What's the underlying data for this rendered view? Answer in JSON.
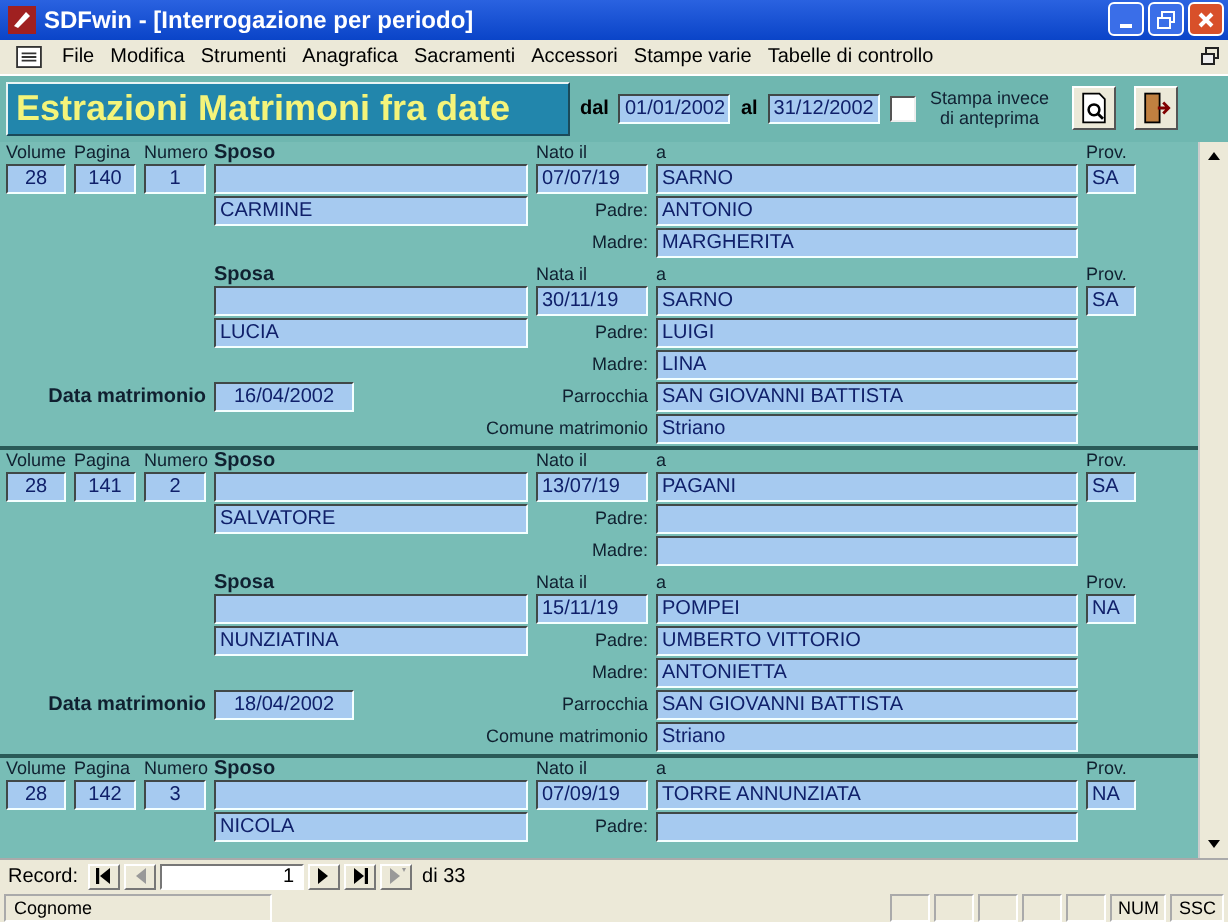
{
  "window": {
    "title": "SDFwin - [Interrogazione per periodo]"
  },
  "menu": [
    "File",
    "Modifica",
    "Strumenti",
    "Anagrafica",
    "Sacramenti",
    "Accessori",
    "Stampe varie",
    "Tabelle di controllo"
  ],
  "header": {
    "title": "Estrazioni Matrimoni fra date",
    "from_label": "dal",
    "from": "01/01/2002",
    "to_label": "al",
    "to": "31/12/2002",
    "print_checkbox": {
      "label": "Stampa invece di anteprima",
      "checked": false
    }
  },
  "records": [
    {
      "volume_label": "Volume",
      "volume": "28",
      "pagina_label": "Pagina",
      "pagina": "140",
      "numero_label": "Numero",
      "numero": "1",
      "persons": [
        {
          "label": "Sposo",
          "nome": "CARMINE",
          "nato_label": "Nato il",
          "nato": "07/07/19",
          "a_label": "a",
          "luogo": "SARNO",
          "prov_label": "Prov.",
          "prov": "SA",
          "padre_label": "Padre:",
          "padre": "ANTONIO",
          "madre_label": "Madre:",
          "madre": "MARGHERITA"
        },
        {
          "label": "Sposa",
          "nome": "LUCIA",
          "nato_label": "Nata il",
          "nato": "30/11/19",
          "a_label": "a",
          "luogo": "SARNO",
          "prov_label": "Prov.",
          "prov": "SA",
          "padre_label": "Padre:",
          "padre": "LUIGI",
          "madre_label": "Madre:",
          "madre": "LINA"
        }
      ],
      "data_label": "Data matrimonio",
      "data": "16/04/2002",
      "parrocchia_label": "Parrocchia",
      "parrocchia": "SAN GIOVANNI BATTISTA",
      "comune_label": "Comune matrimonio",
      "comune": "Striano"
    },
    {
      "volume_label": "Volume",
      "volume": "28",
      "pagina_label": "Pagina",
      "pagina": "141",
      "numero_label": "Numero",
      "numero": "2",
      "persons": [
        {
          "label": "Sposo",
          "nome": "SALVATORE",
          "nato_label": "Nato il",
          "nato": "13/07/19",
          "a_label": "a",
          "luogo": "PAGANI",
          "prov_label": "Prov.",
          "prov": "SA",
          "padre_label": "Padre:",
          "madre_label": "Madre:"
        },
        {
          "label": "Sposa",
          "nome": "NUNZIATINA",
          "nato_label": "Nata il",
          "nato": "15/11/19",
          "a_label": "a",
          "luogo": "POMPEI",
          "prov_label": "Prov.",
          "prov": "NA",
          "padre_label": "Padre:",
          "padre": "UMBERTO VITTORIO",
          "madre_label": "Madre:",
          "madre": "ANTONIETTA"
        }
      ],
      "data_label": "Data matrimonio",
      "data": "18/04/2002",
      "parrocchia_label": "Parrocchia",
      "parrocchia": "SAN GIOVANNI BATTISTA",
      "comune_label": "Comune matrimonio",
      "comune": "Striano"
    },
    {
      "volume_label": "Volume",
      "volume": "28",
      "pagina_label": "Pagina",
      "pagina": "142",
      "numero_label": "Numero",
      "numero": "3",
      "persons": [
        {
          "label": "Sposo",
          "nome": "NICOLA",
          "nato_label": "Nato il",
          "nato": "07/09/19",
          "a_label": "a",
          "luogo": "TORRE ANNUNZIATA",
          "prov_label": "Prov.",
          "prov": "NA",
          "padre_label": "Padre:"
        }
      ]
    }
  ],
  "navigator": {
    "label": "Record:",
    "buttons": [
      {
        "kind": "first",
        "disabled": false
      },
      {
        "kind": "prev",
        "disabled": true
      },
      {
        "kind": "next",
        "disabled": false
      },
      {
        "kind": "last",
        "disabled": false
      },
      {
        "kind": "new",
        "disabled": true
      }
    ],
    "current": "1",
    "total": "di 33"
  },
  "status_bar": {
    "text": "Cognome",
    "indicators": [
      "NUM",
      "SSC"
    ]
  }
}
